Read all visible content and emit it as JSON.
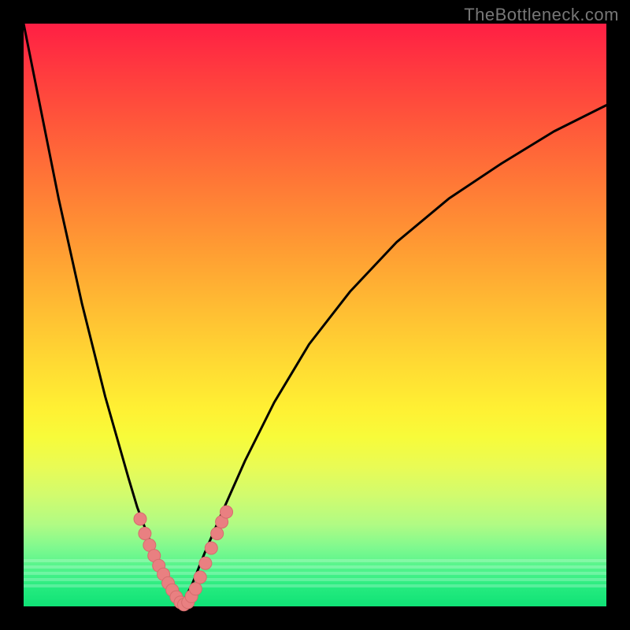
{
  "watermark": "TheBottleneck.com",
  "colors": {
    "frame": "#000000",
    "curve": "#000000",
    "marker_fill": "#e98081",
    "marker_stroke": "#d66c6d"
  },
  "chart_data": {
    "type": "line",
    "title": "",
    "xlabel": "",
    "ylabel": "",
    "xlim": [
      0,
      100
    ],
    "ylim": [
      0,
      100
    ],
    "grid": false,
    "legend": false,
    "series": [
      {
        "name": "left-curve",
        "x": [
          0,
          2,
          4,
          6,
          8,
          10,
          12,
          14,
          16,
          18,
          19.5,
          21,
          22.5,
          24,
          25,
          26,
          27
        ],
        "values": [
          100,
          90,
          80,
          70,
          61,
          52,
          44,
          36,
          29,
          22,
          17,
          13,
          9,
          5.5,
          3,
          1.2,
          0
        ]
      },
      {
        "name": "right-curve",
        "x": [
          27,
          29,
          31,
          34,
          38,
          43,
          49,
          56,
          64,
          73,
          82,
          91,
          100
        ],
        "values": [
          0,
          4,
          9,
          16,
          25,
          35,
          45,
          54,
          62.5,
          70,
          76,
          81.5,
          86
        ]
      },
      {
        "name": "markers",
        "kind": "scatter",
        "x": [
          20,
          20.8,
          21.6,
          22.4,
          23.2,
          24,
          24.8,
          25.5,
          26.2,
          26.9,
          27.5,
          28.2,
          28.8,
          29.5,
          30.3,
          31.2,
          32.2,
          33.2,
          34,
          34.8
        ],
        "values": [
          15,
          12.5,
          10.5,
          8.7,
          7,
          5.5,
          4,
          2.8,
          1.6,
          0.7,
          0.3,
          0.7,
          1.7,
          3,
          5,
          7.4,
          10,
          12.5,
          14.5,
          16.2
        ]
      }
    ]
  }
}
